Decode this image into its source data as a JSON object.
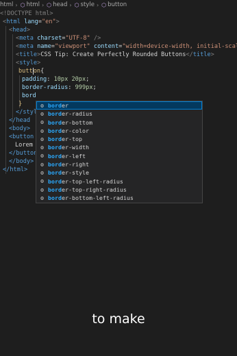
{
  "breadcrumb": [
    {
      "label": "html",
      "icon": "file-html-icon"
    },
    {
      "label": "html",
      "icon": "element-icon"
    },
    {
      "label": "head",
      "icon": "element-icon"
    },
    {
      "label": "style",
      "icon": "element-icon"
    },
    {
      "label": "button",
      "icon": "element-icon"
    }
  ],
  "code": {
    "l1": "<!DOCTYPE html>",
    "l2_tag": "html",
    "l2_attr": "lang",
    "l2_val": "\"en\"",
    "l3_tag": "head",
    "l4_tag": "meta",
    "l4_attr": "charset",
    "l4_val": "\"UTF-8\"",
    "l5_tag": "meta",
    "l5_attr1": "name",
    "l5_val1": "\"viewport\"",
    "l5_attr2": "content",
    "l5_val2": "\"width=device-width, initial-scale=",
    "l6_tag": "title",
    "l6_text": "CSS Tip: Create Perfectly Rounded Buttons",
    "l7_tag": "style",
    "l8_sel_a": "butt",
    "l8_sel_b": "on",
    "l9_prop": "padding",
    "l9_val": "10px 20px",
    "l10_prop": "border-radius",
    "l10_val": "999px",
    "l11_typed": "bord",
    "l12": "}",
    "l13": "</styl",
    "l14": "</head",
    "l15": "<body>",
    "l16": "<button",
    "l17": "Lorem",
    "l18": "</button",
    "l19": "</body>",
    "l20": "</html>"
  },
  "suggestions": {
    "typed": "bord",
    "items": [
      {
        "match": "bord",
        "rest": "er"
      },
      {
        "match": "bord",
        "rest": "er-radius"
      },
      {
        "match": "bord",
        "rest": "er-bottom"
      },
      {
        "match": "bord",
        "rest": "er-color"
      },
      {
        "match": "bord",
        "rest": "er-top"
      },
      {
        "match": "bord",
        "rest": "er-width"
      },
      {
        "match": "bord",
        "rest": "er-left"
      },
      {
        "match": "bord",
        "rest": "er-right"
      },
      {
        "match": "bord",
        "rest": "er-style"
      },
      {
        "match": "bord",
        "rest": "er-top-left-radius"
      },
      {
        "match": "bord",
        "rest": "er-top-right-radius"
      },
      {
        "match": "bord",
        "rest": "er-bottom-left-radius"
      }
    ]
  },
  "caption": "to make",
  "colors": {
    "background": "#1e1e1e",
    "suggest_bg": "#252526",
    "highlight": "#04395e",
    "match": "#2aaaff"
  }
}
